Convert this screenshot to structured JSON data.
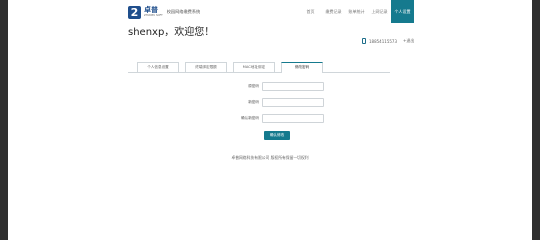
{
  "header": {
    "logo_mark": "2",
    "brand": "卓普",
    "brand_sub": "ZHUOPU SOFT",
    "system_name": "校园网络缴费系统",
    "nav": [
      {
        "label": "首页",
        "active": false
      },
      {
        "label": "缴费记录",
        "active": false
      },
      {
        "label": "账单统计",
        "active": false
      },
      {
        "label": "上网记录",
        "active": false
      },
      {
        "label": "个人设置",
        "active": true
      }
    ]
  },
  "greeting": "shenxp，欢迎您！",
  "user": {
    "phone": "18854115573",
    "logout_label": "+退出"
  },
  "tabs": [
    {
      "label": "个人信息设置",
      "active": false
    },
    {
      "label": "终端绑定限额",
      "active": false
    },
    {
      "label": "MAC地址绑定",
      "active": false
    },
    {
      "label": "修改密码",
      "active": true
    }
  ],
  "form": {
    "old_password_label": "原密码",
    "new_password_label": "新密码",
    "confirm_password_label": "确认新密码",
    "old_password_value": "",
    "new_password_value": "",
    "confirm_password_value": "",
    "submit_label": "确认修改"
  },
  "footer": "卓普网络科技有限公司 版权所有保留一切权利",
  "colors": {
    "accent": "#157a8e",
    "background_frame": "#2f2f2f"
  }
}
